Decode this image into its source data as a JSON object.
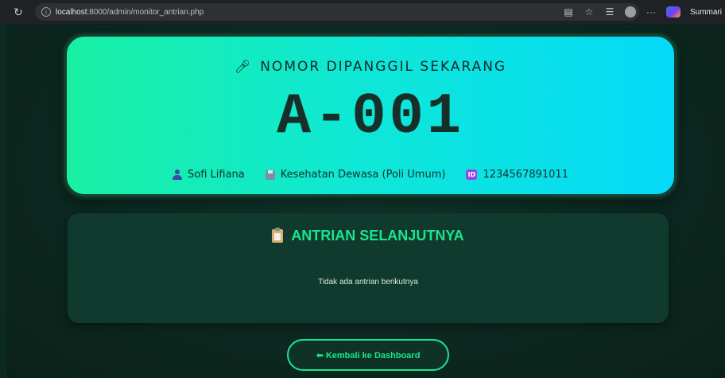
{
  "browser": {
    "url_host": "localhost",
    "url_path": ":8000/admin/monitor_antrian.php",
    "summary_label": "Summari"
  },
  "now_serving": {
    "title": "NOMOR DIPANGGIL SEKARANG",
    "number": "A-001",
    "patient_name": "Sofi Lifiana",
    "clinic": "Kesehatan Dewasa (Poli Umum)",
    "patient_id": "1234567891011",
    "id_badge": "ID"
  },
  "next_queue": {
    "title": "ANTRIAN SELANJUTNYA",
    "empty_message": "Tidak ada antrian berikutnya"
  },
  "back_button": {
    "label": "⬅ Kembali ke Dashboard"
  },
  "colors": {
    "accent": "#19e58f",
    "card_gradient_start": "#19f0a3",
    "card_gradient_end": "#06d9f8",
    "background": "#0d2a22"
  }
}
